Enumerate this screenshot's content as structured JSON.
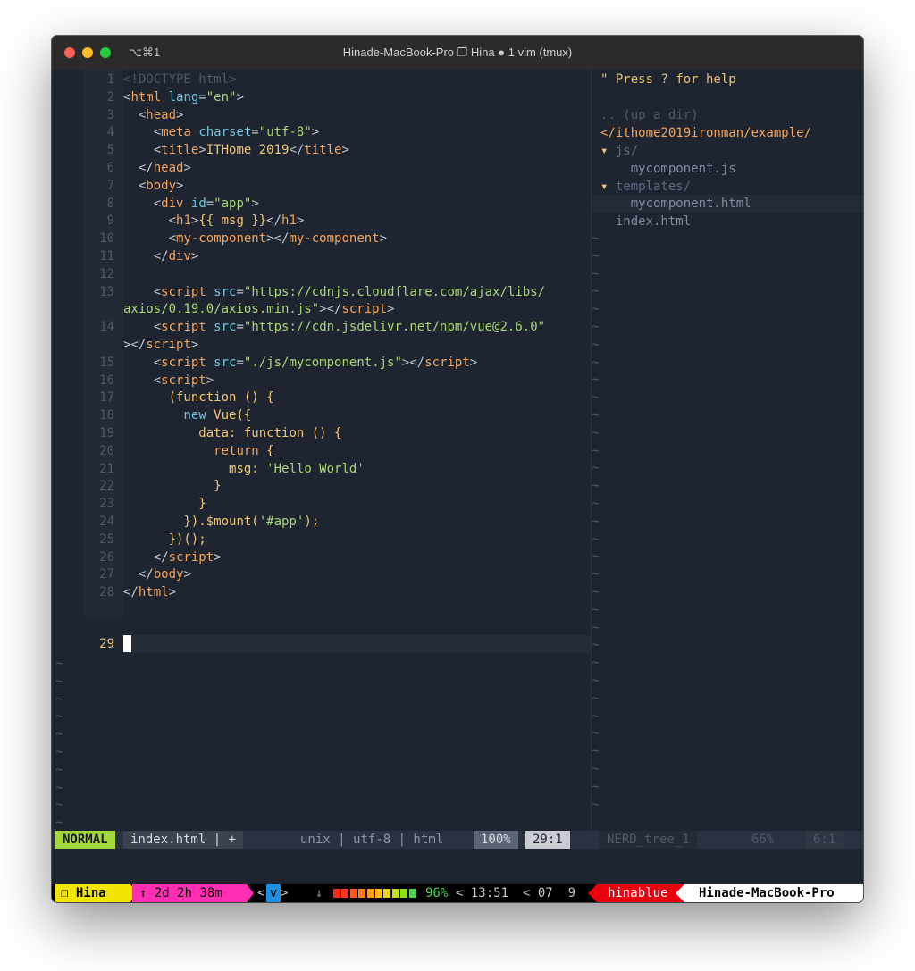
{
  "titlebar": {
    "shortcut": "⌥⌘1",
    "title": "Hinade-MacBook-Pro ❐ Hina ● 1 vim (tmux)"
  },
  "editor": {
    "lines": [
      {
        "n": "1",
        "html": "<span class='tline-comment' style='color:#4f596a'>&lt;!DOCTYPE html&gt;</span>"
      },
      {
        "n": "2",
        "html": "<span class='p'>&lt;</span><span class='t'>html</span> <span class='a'>lang</span><span class='p'>=</span><span class='s'>\"en\"</span><span class='p'>&gt;</span>"
      },
      {
        "n": "3",
        "html": "  <span class='p'>&lt;</span><span class='t'>head</span><span class='p'>&gt;</span>"
      },
      {
        "n": "4",
        "html": "    <span class='p'>&lt;</span><span class='t'>meta</span> <span class='a'>charset</span><span class='p'>=</span><span class='s'>\"utf-8\"</span><span class='p'>&gt;</span>"
      },
      {
        "n": "5",
        "html": "    <span class='p'>&lt;</span><span class='t'>title</span><span class='p'>&gt;</span><span class='k'>ITHome 2019</span><span class='p'>&lt;/</span><span class='t'>title</span><span class='p'>&gt;</span>"
      },
      {
        "n": "6",
        "html": "  <span class='p'>&lt;/</span><span class='t'>head</span><span class='p'>&gt;</span>"
      },
      {
        "n": "7",
        "html": "  <span class='p'>&lt;</span><span class='t'>body</span><span class='p'>&gt;</span>"
      },
      {
        "n": "8",
        "html": "    <span class='p'>&lt;</span><span class='t'>div</span> <span class='a'>id</span><span class='p'>=</span><span class='s'>\"app\"</span><span class='p'>&gt;</span>"
      },
      {
        "n": "9",
        "html": "      <span class='p'>&lt;</span><span class='t'>h1</span><span class='p'>&gt;</span><span class='k'>{{ msg }}</span><span class='p'>&lt;/</span><span class='t'>h1</span><span class='p'>&gt;</span>"
      },
      {
        "n": "10",
        "html": "      <span class='p'>&lt;</span><span class='t'>my-component</span><span class='p'>&gt;&lt;/</span><span class='t'>my-component</span><span class='p'>&gt;</span>"
      },
      {
        "n": "11",
        "html": "    <span class='p'>&lt;/</span><span class='t'>div</span><span class='p'>&gt;</span>"
      },
      {
        "n": "12",
        "html": ""
      },
      {
        "n": "13",
        "html": "    <span class='p'>&lt;</span><span class='t'>script</span> <span class='a'>src</span><span class='p'>=</span><span class='s'>\"https://cdnjs.cloudflare.com/ajax/libs/</span>"
      },
      {
        "n": "",
        "html": "<span class='s'>axios/0.19.0/axios.min.js\"</span><span class='p'>&gt;&lt;/</span><span class='t'>script</span><span class='p'>&gt;</span>"
      },
      {
        "n": "14",
        "html": "    <span class='p'>&lt;</span><span class='t'>script</span> <span class='a'>src</span><span class='p'>=</span><span class='s'>\"https://cdn.jsdelivr.net/npm/vue@2.6.0\"</span>"
      },
      {
        "n": "",
        "html": "<span class='p'>&gt;&lt;/</span><span class='t'>script</span><span class='p'>&gt;</span>"
      },
      {
        "n": "15",
        "html": "    <span class='p'>&lt;</span><span class='t'>script</span> <span class='a'>src</span><span class='p'>=</span><span class='s'>\"./js/mycomponent.js\"</span><span class='p'>&gt;&lt;/</span><span class='t'>script</span><span class='p'>&gt;</span>"
      },
      {
        "n": "16",
        "html": "    <span class='p'>&lt;</span><span class='t'>script</span><span class='p'>&gt;</span>"
      },
      {
        "n": "17",
        "html": "      <span class='k'>(function () {</span>"
      },
      {
        "n": "18",
        "html": "        <span class='a'>new</span> <span class='k'>Vue({</span>"
      },
      {
        "n": "19",
        "html": "          <span class='k'>data: function () {</span>"
      },
      {
        "n": "20",
        "html": "            <span class='t'>return</span> <span class='k'>{</span>"
      },
      {
        "n": "21",
        "html": "              <span class='k'>msg: </span><span class='s'>'Hello World'</span>"
      },
      {
        "n": "22",
        "html": "            <span class='k'>}</span>"
      },
      {
        "n": "23",
        "html": "          <span class='k'>}</span>"
      },
      {
        "n": "24",
        "html": "        <span class='k'>}).$mount(</span><span class='s'>'#app'</span><span class='k'>);</span>"
      },
      {
        "n": "25",
        "html": "      <span class='k'>})();</span>"
      },
      {
        "n": "26",
        "html": "    <span class='p'>&lt;/</span><span class='t'>script</span><span class='p'>&gt;</span>"
      },
      {
        "n": "27",
        "html": "  <span class='p'>&lt;/</span><span class='t'>body</span><span class='p'>&gt;</span>"
      },
      {
        "n": "28",
        "html": "<span class='p'>&lt;/</span><span class='t'>html</span><span class='p'>&gt;</span>"
      }
    ],
    "current_line_number": "29",
    "tilde": "~"
  },
  "nerdtree": {
    "help": "\" Press ? for help",
    "up": ".. (up a dir)",
    "root": "</ithome2019ironman/example/",
    "items": [
      {
        "text": "▾ js/",
        "kind": "dir"
      },
      {
        "text": "    mycomponent.js",
        "kind": "file"
      },
      {
        "text": "▾ templates/",
        "kind": "dir"
      },
      {
        "text": "    mycomponent.html",
        "kind": "file"
      },
      {
        "text": "  index.html",
        "kind": "file"
      }
    ]
  },
  "statusline": {
    "mode": "NORMAL",
    "filename": "index.html | +",
    "fileinfo": "unix | utf-8 | html",
    "percent": "100%",
    "position": "29:1",
    "nerd_name": "NERD_tree_1",
    "nerd_percent": "66%",
    "nerd_position": "6:1"
  },
  "tmux": {
    "session": "❐ Hina",
    "uptime": "↑ 2d 2h 38m",
    "window_prefix": "<",
    "window_v": "v",
    "window_suffix": ">",
    "arrow": "↓",
    "battery_percent": "96%",
    "battery_level": 0.96,
    "time": "< 13:51",
    "date": "< 07  9",
    "user": "hinablue",
    "host": "Hinade-MacBook-Pro",
    "colors": {
      "session_bg": "#f4e500",
      "uptime_bg": "#ff2fb3",
      "user_bg": "#e8000f",
      "battery_good": "#4dd34d"
    }
  }
}
